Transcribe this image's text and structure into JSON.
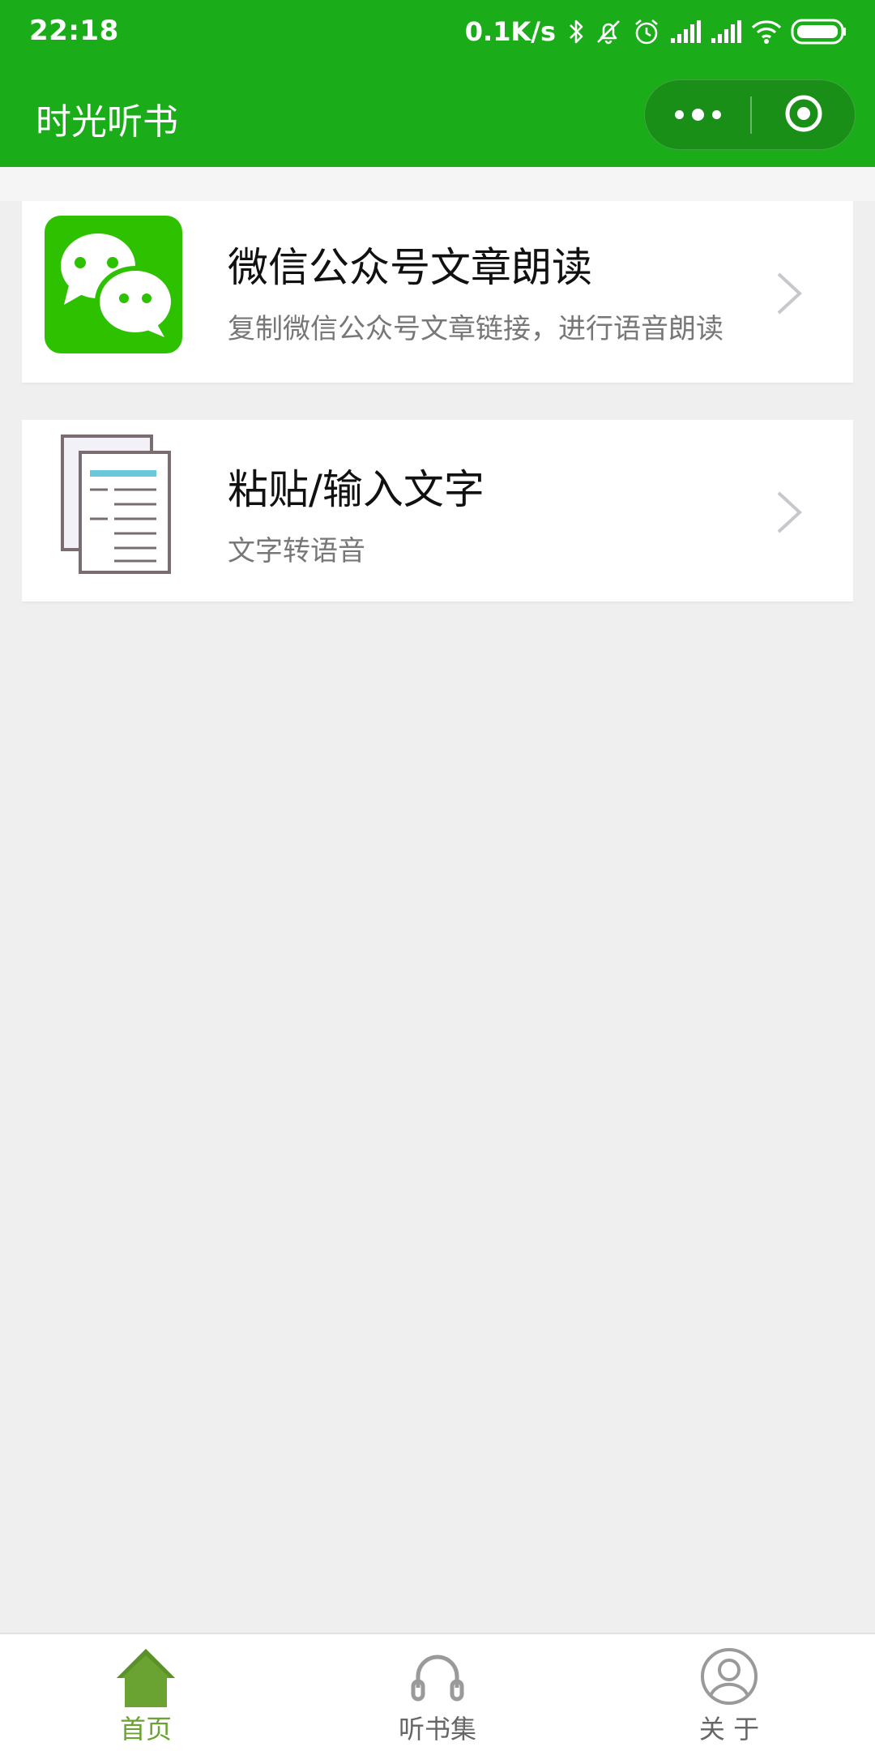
{
  "status_bar": {
    "time": "22:18",
    "net_speed": "0.1K/s"
  },
  "nav_bar": {
    "title": "时光听书",
    "more_label": "更多",
    "close_label": "关闭"
  },
  "items": [
    {
      "icon": "wechat-icon",
      "title": "微信公众号文章朗读",
      "subtitle": "复制微信公众号文章链接，进行语音朗读"
    },
    {
      "icon": "document-icon",
      "title": "粘贴/输入文字",
      "subtitle": "文字转语音"
    }
  ],
  "tabbar": {
    "tabs": [
      {
        "label": "首页",
        "icon": "home-icon",
        "active": true
      },
      {
        "label": "听书集",
        "icon": "headphones-icon",
        "active": false
      },
      {
        "label": "关 于",
        "icon": "user-icon",
        "active": false
      }
    ]
  },
  "colors": {
    "brand_green": "#1aad19",
    "wechat_green": "#2dc100",
    "tab_active": "#6aa332"
  }
}
